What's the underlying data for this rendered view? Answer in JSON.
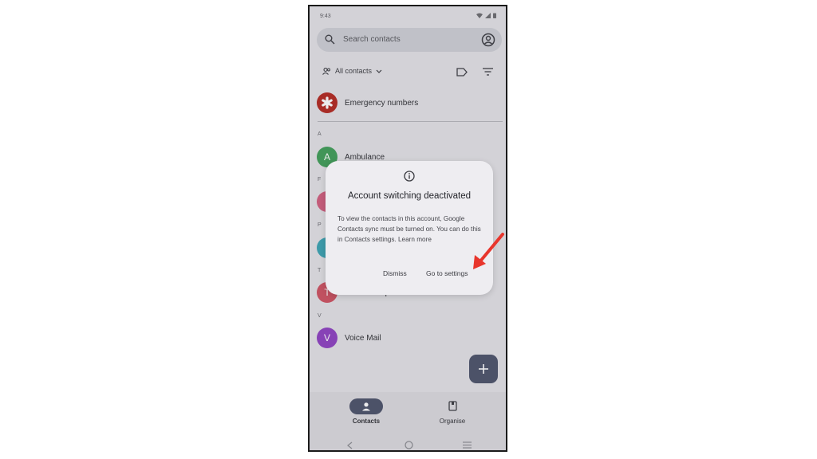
{
  "status_bar": {
    "time": "9:43"
  },
  "search": {
    "placeholder": "Search contacts"
  },
  "toolbar": {
    "filter_label": "All contacts"
  },
  "emergency": {
    "label": "Emergency numbers",
    "color": "#b3261e"
  },
  "sections": [
    {
      "letter": "A"
    },
    {
      "letter": "F"
    },
    {
      "letter": "P"
    },
    {
      "letter": "T"
    },
    {
      "letter": "V"
    }
  ],
  "contacts": [
    {
      "initial": "A",
      "name": "Ambulance",
      "color": "#3e9e57"
    },
    {
      "initial": "",
      "name": "",
      "color": "#d25d7e"
    },
    {
      "initial": "",
      "name": "",
      "color": "#39a3b3"
    },
    {
      "initial": "T",
      "name": "Telenor Helpline",
      "color": "#cf5060"
    },
    {
      "initial": "V",
      "name": "Voice Mail",
      "color": "#8e3fc2"
    }
  ],
  "dialog": {
    "title": "Account switching deactivated",
    "body": "To view the contacts in this account, Google Contacts sync must be turned on. You can do this in Contacts settings. Learn more",
    "dismiss_label": "Dismiss",
    "settings_label": "Go to settings"
  },
  "fab": {
    "icon": "plus-icon"
  },
  "bottom_nav": {
    "items": [
      {
        "label": "Contacts",
        "active": true
      },
      {
        "label": "Organise",
        "active": false
      }
    ]
  },
  "annotation": {
    "color": "#e8352c"
  }
}
